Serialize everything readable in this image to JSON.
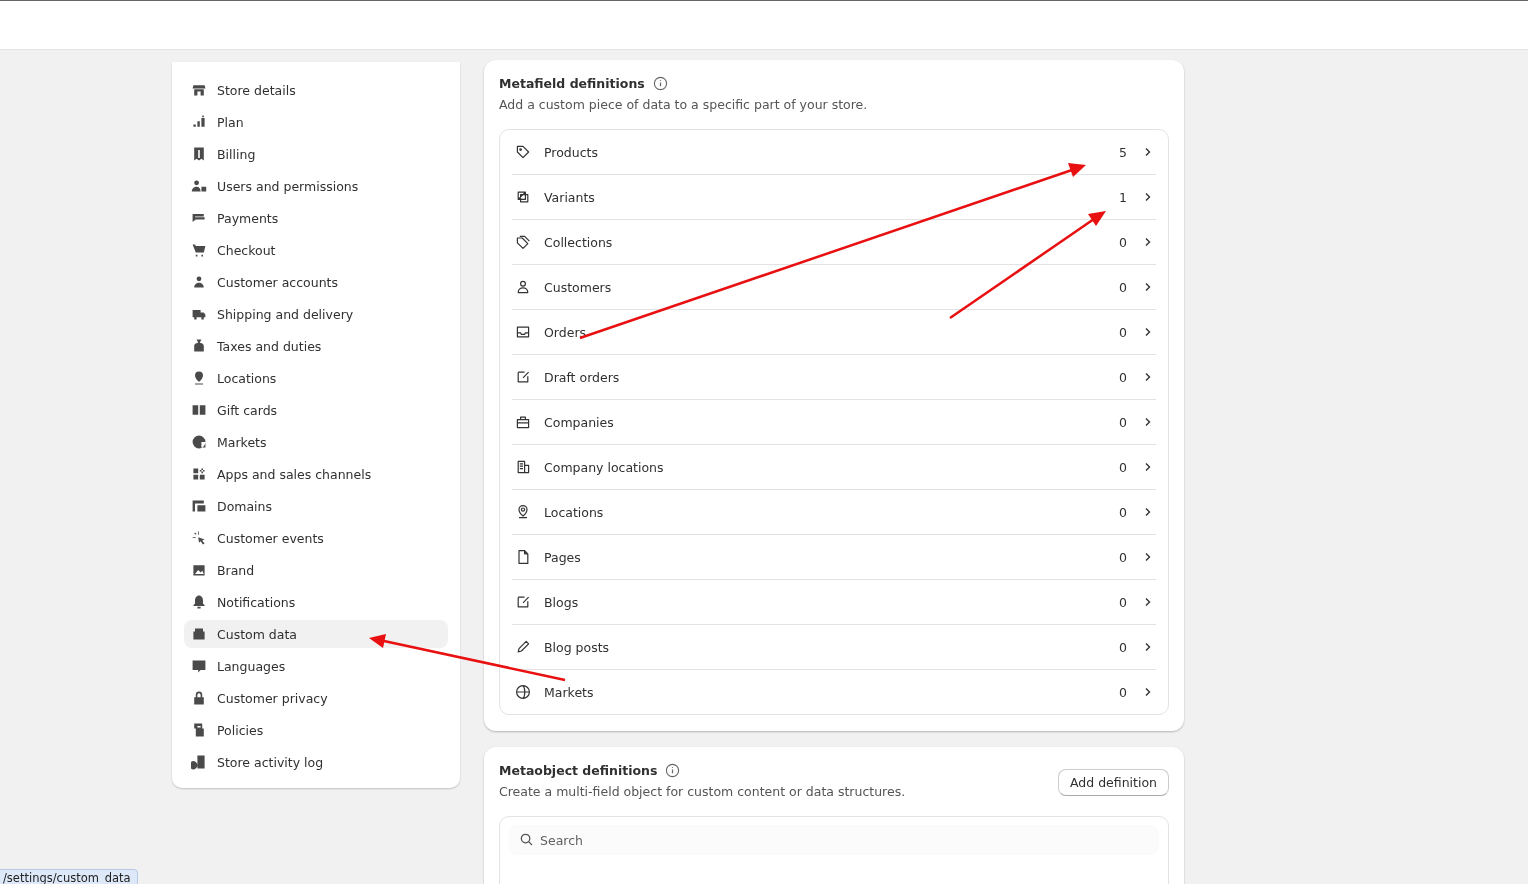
{
  "sidebar": {
    "items": [
      {
        "label": "Store details",
        "selected": false
      },
      {
        "label": "Plan",
        "selected": false
      },
      {
        "label": "Billing",
        "selected": false
      },
      {
        "label": "Users and permissions",
        "selected": false
      },
      {
        "label": "Payments",
        "selected": false
      },
      {
        "label": "Checkout",
        "selected": false
      },
      {
        "label": "Customer accounts",
        "selected": false
      },
      {
        "label": "Shipping and delivery",
        "selected": false
      },
      {
        "label": "Taxes and duties",
        "selected": false
      },
      {
        "label": "Locations",
        "selected": false
      },
      {
        "label": "Gift cards",
        "selected": false
      },
      {
        "label": "Markets",
        "selected": false
      },
      {
        "label": "Apps and sales channels",
        "selected": false
      },
      {
        "label": "Domains",
        "selected": false
      },
      {
        "label": "Customer events",
        "selected": false
      },
      {
        "label": "Brand",
        "selected": false
      },
      {
        "label": "Notifications",
        "selected": false
      },
      {
        "label": "Custom data",
        "selected": true
      },
      {
        "label": "Languages",
        "selected": false
      },
      {
        "label": "Customer privacy",
        "selected": false
      },
      {
        "label": "Policies",
        "selected": false
      },
      {
        "label": "Store activity log",
        "selected": false
      }
    ]
  },
  "metafields": {
    "title": "Metafield definitions",
    "subtitle": "Add a custom piece of data to a specific part of your store.",
    "rows": [
      {
        "label": "Products",
        "count": "5"
      },
      {
        "label": "Variants",
        "count": "1"
      },
      {
        "label": "Collections",
        "count": "0"
      },
      {
        "label": "Customers",
        "count": "0"
      },
      {
        "label": "Orders",
        "count": "0"
      },
      {
        "label": "Draft orders",
        "count": "0"
      },
      {
        "label": "Companies",
        "count": "0"
      },
      {
        "label": "Company locations",
        "count": "0"
      },
      {
        "label": "Locations",
        "count": "0"
      },
      {
        "label": "Pages",
        "count": "0"
      },
      {
        "label": "Blogs",
        "count": "0"
      },
      {
        "label": "Blog posts",
        "count": "0"
      },
      {
        "label": "Markets",
        "count": "0"
      }
    ]
  },
  "metaobjects": {
    "title": "Metaobject definitions",
    "subtitle": "Create a multi-field object for custom content or data structures.",
    "button": "Add definition",
    "search": {
      "placeholder": "Search"
    }
  },
  "status_url": "/settings/custom_data"
}
